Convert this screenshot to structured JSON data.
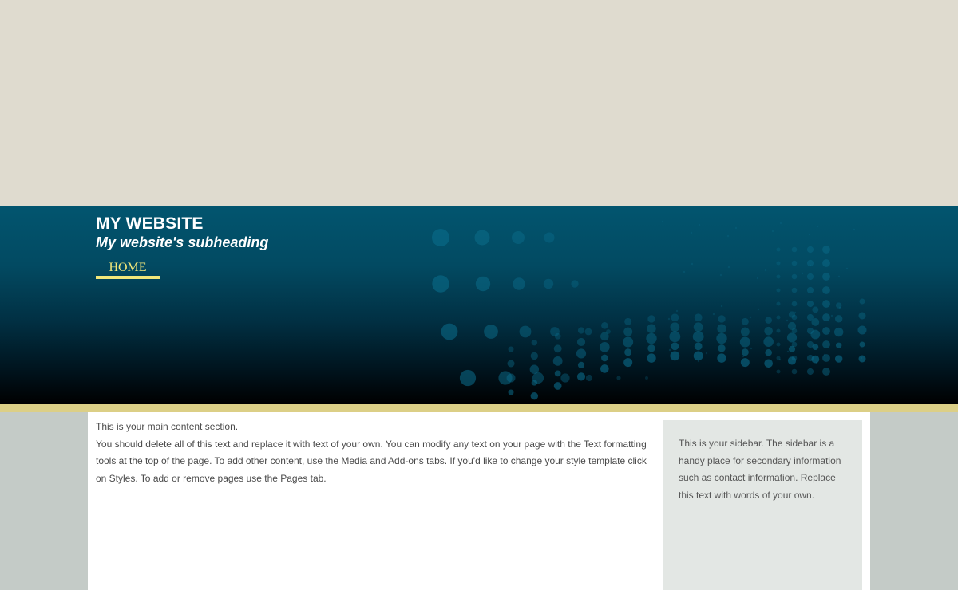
{
  "site": {
    "title": "MY WEBSITE",
    "subheading": "My website's subheading"
  },
  "nav": {
    "items": [
      {
        "label": "HOME",
        "active": true
      }
    ]
  },
  "main": {
    "heading_line": "This is your main content section.",
    "body": "You should delete all of this text and replace it with text of your own. You can modify any text on your page with the Text formatting tools at the top of the page. To add other content, use the Media and Add-ons tabs. If you'd like to change your style template click on Styles. To add or remove pages use the Pages tab."
  },
  "sidebar": {
    "text": "This is your sidebar. The sidebar is a handy place for secondary information such as contact information. Replace this text with words of your own."
  },
  "colors": {
    "top_band": "#dfdbcf",
    "header_top": "#02556f",
    "header_bottom": "#000000",
    "nav_accent": "#f2e77a",
    "gold_stripe": "#dccf86",
    "page_bg": "#c4cbc7",
    "content_bg": "#ffffff",
    "sidebar_bg": "#e3e7e4"
  }
}
